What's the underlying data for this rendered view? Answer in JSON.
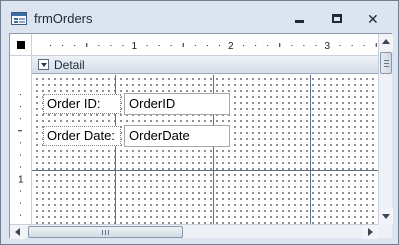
{
  "window": {
    "title": "frmOrders",
    "icon": "form-icon",
    "controls": {
      "minimize": "minimize-icon",
      "maximize": "maximize-icon",
      "close": "close-icon"
    }
  },
  "ruler": {
    "horizontal_labels": [
      "1",
      "2",
      "3"
    ],
    "vertical_labels": [
      "1"
    ]
  },
  "section": {
    "label": "Detail"
  },
  "fields": [
    {
      "label": "Order ID:",
      "control": "OrderID"
    },
    {
      "label": "Order Date:",
      "control": "OrderDate"
    }
  ],
  "colors": {
    "grid_line": "#5e6f88",
    "window_frame": "#dbe4ef",
    "section_header": "#d4dde8"
  }
}
